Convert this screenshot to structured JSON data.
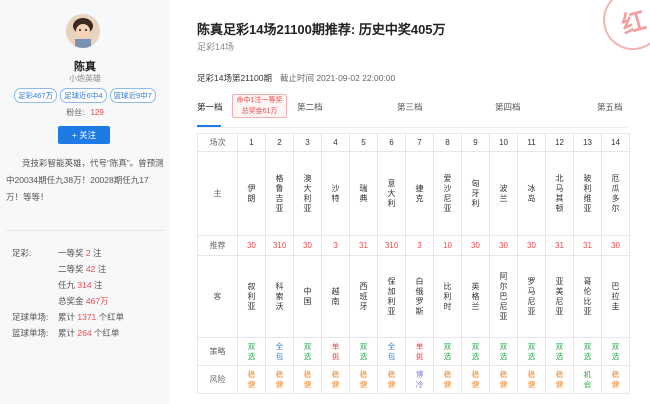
{
  "expert": {
    "name": "陈真",
    "title": "小炮英雄",
    "tags": [
      "足彩467万",
      "足球近6中4",
      "篮球近9中7"
    ],
    "fans_label": "粉丝:",
    "fans": "129",
    "follow_label": "+ 关注",
    "description": "竞技彩智能英雄，代号“陈真”。曾预测中20034期任九38万！20028期任九17万！等等！"
  },
  "stats": [
    {
      "label": "足彩:",
      "pre": "一等奖 ",
      "val": "2",
      "suf": " 注"
    },
    {
      "label": "",
      "pre": "二等奖 ",
      "val": "42",
      "suf": " 注"
    },
    {
      "label": "",
      "pre": "任九 ",
      "val": "314",
      "suf": " 注"
    },
    {
      "label": "",
      "pre": "总奖金 ",
      "val": "467万",
      "suf": ""
    },
    {
      "label": "足球单场:",
      "pre": "累计 ",
      "val": "1371",
      "suf": " 个红单"
    },
    {
      "label": "篮球单场:",
      "pre": "累计 ",
      "val": "264",
      "suf": " 个红单"
    }
  ],
  "article": {
    "title": "陈真足彩14场21100期推荐: 历史中奖405万",
    "subtitle": "足彩14场",
    "issue": "足彩14场第21100期",
    "deadline": "截止时间 2021-09-02 22:00:00",
    "stamp": "红"
  },
  "tabs": [
    "第一档",
    "第二档",
    "第三档",
    "第四档",
    "第五档"
  ],
  "hit_badge": {
    "line1": "命中1注一等奖",
    "line2": "总奖金61万"
  },
  "table": {
    "labels": {
      "order": "场次",
      "home": "主",
      "rec": "推荐",
      "away": "客",
      "strategy": "策略",
      "risk": "风险"
    },
    "matches": [
      {
        "n": "1",
        "home": "伊朗",
        "rec": "30",
        "away": "叙利亚",
        "strategy": "双选",
        "risk": "稳健"
      },
      {
        "n": "2",
        "home": "格鲁吉亚",
        "rec": "310",
        "away": "科索沃",
        "strategy": "全包",
        "risk": "稳健"
      },
      {
        "n": "3",
        "home": "澳大利亚",
        "rec": "30",
        "away": "中国",
        "strategy": "双选",
        "risk": "稳健"
      },
      {
        "n": "4",
        "home": "沙特",
        "rec": "3",
        "away": "越南",
        "strategy": "单挑",
        "risk": "稳健"
      },
      {
        "n": "5",
        "home": "瑞典",
        "rec": "31",
        "away": "西班牙",
        "strategy": "双选",
        "risk": "稳健"
      },
      {
        "n": "6",
        "home": "意大利",
        "rec": "310",
        "away": "保加利亚",
        "strategy": "全包",
        "risk": "稳健"
      },
      {
        "n": "7",
        "home": "捷克",
        "rec": "3",
        "away": "白俄罗斯",
        "strategy": "单挑",
        "risk": "博冷"
      },
      {
        "n": "8",
        "home": "爱沙尼亚",
        "rec": "10",
        "away": "比利时",
        "strategy": "双选",
        "risk": "稳健"
      },
      {
        "n": "9",
        "home": "匈牙利",
        "rec": "30",
        "away": "英格兰",
        "strategy": "双选",
        "risk": "稳健"
      },
      {
        "n": "10",
        "home": "波兰",
        "rec": "30",
        "away": "阿尔巴尼亚",
        "strategy": "双选",
        "risk": "稳健"
      },
      {
        "n": "11",
        "home": "冰岛",
        "rec": "30",
        "away": "罗马尼亚",
        "strategy": "双选",
        "risk": "稳健"
      },
      {
        "n": "12",
        "home": "北马其顿",
        "rec": "31",
        "away": "亚美尼亚",
        "strategy": "双选",
        "risk": "稳健"
      },
      {
        "n": "13",
        "home": "玻利维亚",
        "rec": "31",
        "away": "哥伦比亚",
        "strategy": "双选",
        "risk": "机会"
      },
      {
        "n": "14",
        "home": "厄瓜多尔",
        "rec": "30",
        "away": "巴拉圭",
        "strategy": "双选",
        "risk": "稳健"
      }
    ]
  },
  "colors": {
    "accent": "#1e7be6",
    "highlight": "#f04848",
    "double": "#29a84a",
    "all": "#2f7bd8",
    "single": "#f04848",
    "steady": "#f08a2a",
    "cold": "#7a7ae0"
  }
}
